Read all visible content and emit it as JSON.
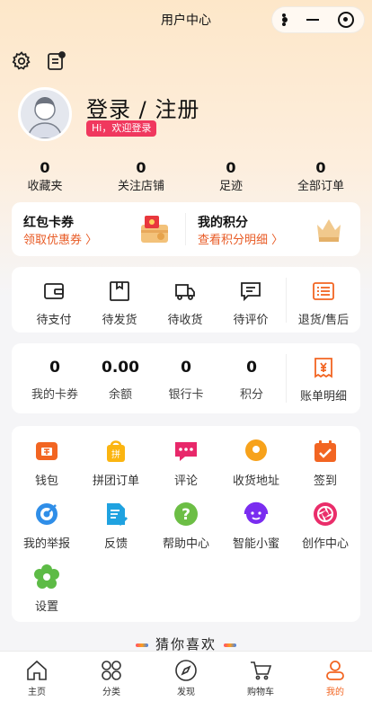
{
  "topbar": {
    "title": "用户中心"
  },
  "header_icons": {
    "settings": "gear-icon",
    "messages": "message-list-icon"
  },
  "profile": {
    "title": "登录 / 注册",
    "badge": "Hi，欢迎登录"
  },
  "stats": [
    {
      "value": "0",
      "label": "收藏夹"
    },
    {
      "value": "0",
      "label": "关注店铺"
    },
    {
      "value": "0",
      "label": "足迹"
    },
    {
      "value": "0",
      "label": "全部订单"
    }
  ],
  "promo": {
    "left": {
      "title": "红包卡券",
      "subtitle": "领取优惠券 〉"
    },
    "right": {
      "title": "我的积分",
      "subtitle": "查看积分明细 〉"
    }
  },
  "orders": [
    {
      "label": "待支付",
      "icon": "wallet-icon"
    },
    {
      "label": "待发货",
      "icon": "box-icon"
    },
    {
      "label": "待收货",
      "icon": "truck-icon"
    },
    {
      "label": "待评价",
      "icon": "comment-icon"
    },
    {
      "label": "退货/售后",
      "icon": "return-list-icon"
    }
  ],
  "assets": [
    {
      "value": "0",
      "label": "我的卡券"
    },
    {
      "value": "0.00",
      "label": "余额"
    },
    {
      "value": "0",
      "label": "银行卡"
    },
    {
      "value": "0",
      "label": "积分"
    }
  ],
  "bill": {
    "label": "账单明细",
    "icon": "bill-icon"
  },
  "services": [
    {
      "label": "钱包",
      "icon": "wallet-icon",
      "color": "#f26522"
    },
    {
      "label": "拼团订单",
      "icon": "group-buy-bag-icon",
      "color": "#fbb511"
    },
    {
      "label": "评论",
      "icon": "comment-icon",
      "color": "#e8286a"
    },
    {
      "label": "收货地址",
      "icon": "location-pin-icon",
      "color": "#f7a21b"
    },
    {
      "label": "签到",
      "icon": "calendar-check-icon",
      "color": "#f26522"
    },
    {
      "label": "我的举报",
      "icon": "report-target-icon",
      "color": "#2f8ee8"
    },
    {
      "label": "反馈",
      "icon": "feedback-doc-icon",
      "color": "#1fa2e0"
    },
    {
      "label": "帮助中心",
      "icon": "help-question-icon",
      "color": "#6cbe45"
    },
    {
      "label": "智能小蜜",
      "icon": "smart-assistant-icon",
      "color": "#7a2cf0"
    },
    {
      "label": "创作中心",
      "icon": "camera-aperture-icon",
      "color": "#ea2d6a"
    },
    {
      "label": "设置",
      "icon": "flower-gear-icon",
      "color": "#5dbb46"
    }
  ],
  "guess_title": "猜你喜欢",
  "tabbar": [
    {
      "label": "主页",
      "icon": "home-icon"
    },
    {
      "label": "分类",
      "icon": "grid-category-icon"
    },
    {
      "label": "发现",
      "icon": "compass-icon"
    },
    {
      "label": "购物车",
      "icon": "cart-icon"
    },
    {
      "label": "我的",
      "icon": "user-icon",
      "active": true
    }
  ],
  "colors": {
    "accent": "#f26522",
    "badge": "#f0385e"
  }
}
